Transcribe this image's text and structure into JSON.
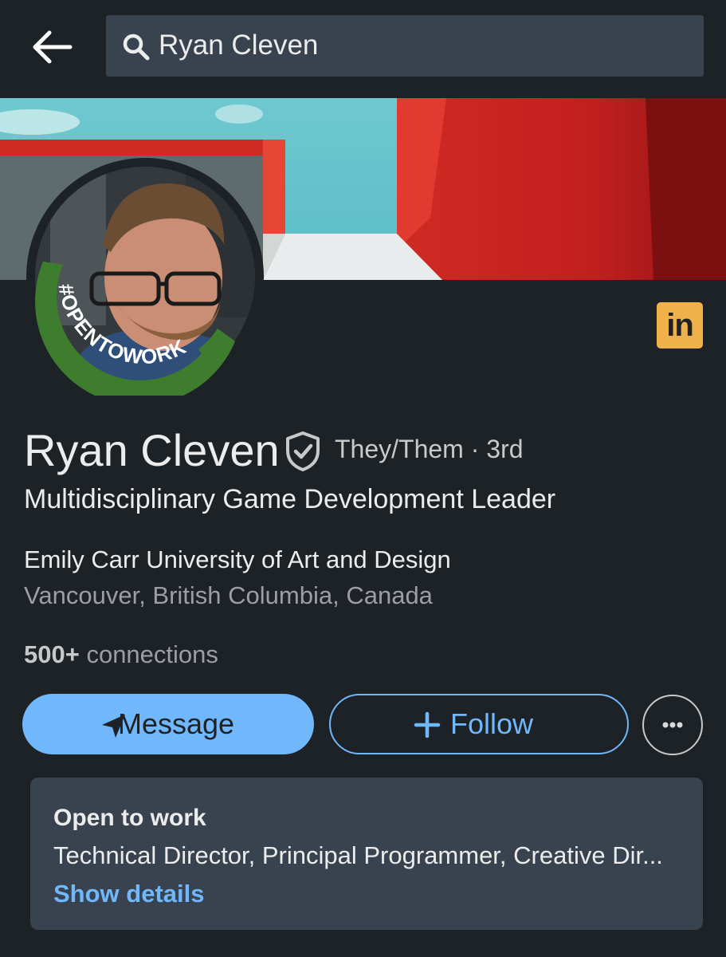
{
  "search": {
    "query": "Ryan Cleven"
  },
  "profile": {
    "open_to_work_frame": "#OPENTOWORK",
    "name": "Ryan Cleven",
    "pronouns": "They/Them",
    "separator": "·",
    "degree": "3rd",
    "headline": "Multidisciplinary Game Development Leader",
    "school": "Emily Carr University of Art and Design",
    "location": "Vancouver, British Columbia, Canada",
    "connections_count": "500+",
    "connections_label": "connections"
  },
  "brand": {
    "badge": "in",
    "badge_color": "#f0b04a"
  },
  "actions": {
    "message_label": "Message",
    "follow_label": "Follow",
    "accent_color": "#71b7fb"
  },
  "open_to_work": {
    "title": "Open to work",
    "roles": "Technical Director, Principal Programmer, Creative Dir...",
    "link_label": "Show details"
  },
  "icons": {
    "back": "arrow-left-icon",
    "search": "search-icon",
    "verified": "shield-check-icon",
    "message": "send-icon",
    "follow": "plus-icon",
    "more": "more-dots-icon"
  }
}
